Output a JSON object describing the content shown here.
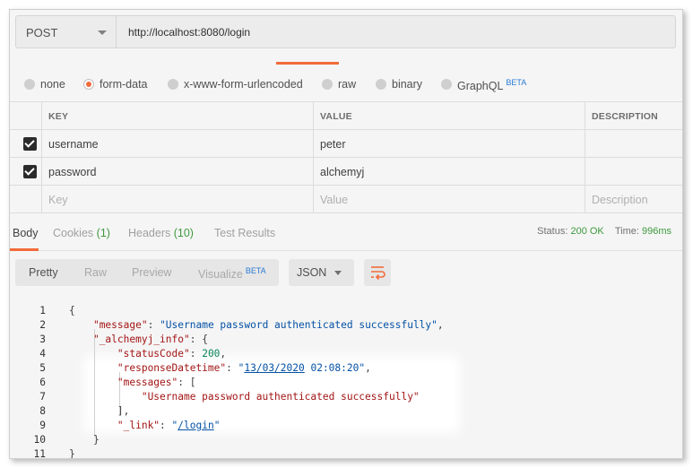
{
  "request": {
    "method": "POST",
    "url": "http://localhost:8080/login"
  },
  "body_types": [
    {
      "label": "none",
      "selected": false
    },
    {
      "label": "form-data",
      "selected": true
    },
    {
      "label": "x-www-form-urlencoded",
      "selected": false
    },
    {
      "label": "raw",
      "selected": false
    },
    {
      "label": "binary",
      "selected": false
    },
    {
      "label": "GraphQL",
      "selected": false,
      "badge": "BETA"
    }
  ],
  "params_table": {
    "headers": [
      "KEY",
      "VALUE",
      "DESCRIPTION"
    ],
    "rows": [
      {
        "checked": true,
        "key": "username",
        "value": "peter",
        "description": ""
      },
      {
        "checked": true,
        "key": "password",
        "value": "alchemyj",
        "description": ""
      }
    ],
    "placeholder": {
      "key": "Key",
      "value": "Value",
      "description": "Description"
    }
  },
  "response_tabs": {
    "body": "Body",
    "cookies": "Cookies",
    "cookies_count": "(1)",
    "headers": "Headers",
    "headers_count": "(10)",
    "test_results": "Test Results"
  },
  "status": {
    "status_label": "Status:",
    "status_value": "200 OK",
    "time_label": "Time:",
    "time_value": "996ms"
  },
  "view_modes": {
    "pretty": "Pretty",
    "raw": "Raw",
    "preview": "Preview",
    "visualize": "Visualize",
    "visualize_badge": "BETA"
  },
  "format": "JSON",
  "colors": {
    "accent": "#f26b3a",
    "success": "#3e9a3e",
    "json_key": "#a31515",
    "json_string": "#0451a5",
    "json_number": "#098658"
  },
  "code_lines": [
    {
      "n": "1",
      "parts": [
        [
          "p",
          "{"
        ]
      ]
    },
    {
      "n": "2",
      "parts": [
        [
          "p",
          "    "
        ],
        [
          "k",
          "\"message\""
        ],
        [
          "p",
          ": "
        ],
        [
          "s",
          "\"Username password authenticated successfully\""
        ],
        [
          "p",
          ","
        ]
      ]
    },
    {
      "n": "3",
      "parts": [
        [
          "p",
          "    "
        ],
        [
          "k",
          "\"_alchemyj_info\""
        ],
        [
          "p",
          ": {"
        ]
      ]
    },
    {
      "n": "4",
      "parts": [
        [
          "p",
          "        "
        ],
        [
          "k",
          "\"statusCode\""
        ],
        [
          "p",
          ": "
        ],
        [
          "n",
          "200"
        ],
        [
          "p",
          ","
        ]
      ]
    },
    {
      "n": "5",
      "parts": [
        [
          "p",
          "        "
        ],
        [
          "k",
          "\"responseDatetime\""
        ],
        [
          "p",
          ": "
        ],
        [
          "s",
          "\""
        ],
        [
          "su",
          "13/03/2020"
        ],
        [
          "s",
          " 02:08:20\""
        ],
        [
          "p",
          ","
        ]
      ]
    },
    {
      "n": "6",
      "parts": [
        [
          "p",
          "        "
        ],
        [
          "k",
          "\"messages\""
        ],
        [
          "p",
          ": ["
        ]
      ]
    },
    {
      "n": "7",
      "parts": [
        [
          "p",
          "            "
        ],
        [
          "k",
          "\"Username password authenticated successfully\""
        ]
      ]
    },
    {
      "n": "8",
      "parts": [
        [
          "p",
          "        ],"
        ]
      ]
    },
    {
      "n": "9",
      "parts": [
        [
          "p",
          "        "
        ],
        [
          "k",
          "\"_link\""
        ],
        [
          "p",
          ": "
        ],
        [
          "s",
          "\""
        ],
        [
          "su",
          "/login"
        ],
        [
          "s",
          "\""
        ]
      ]
    },
    {
      "n": "10",
      "parts": [
        [
          "p",
          "    }"
        ]
      ]
    },
    {
      "n": "11",
      "parts": [
        [
          "p",
          "}"
        ]
      ]
    }
  ]
}
